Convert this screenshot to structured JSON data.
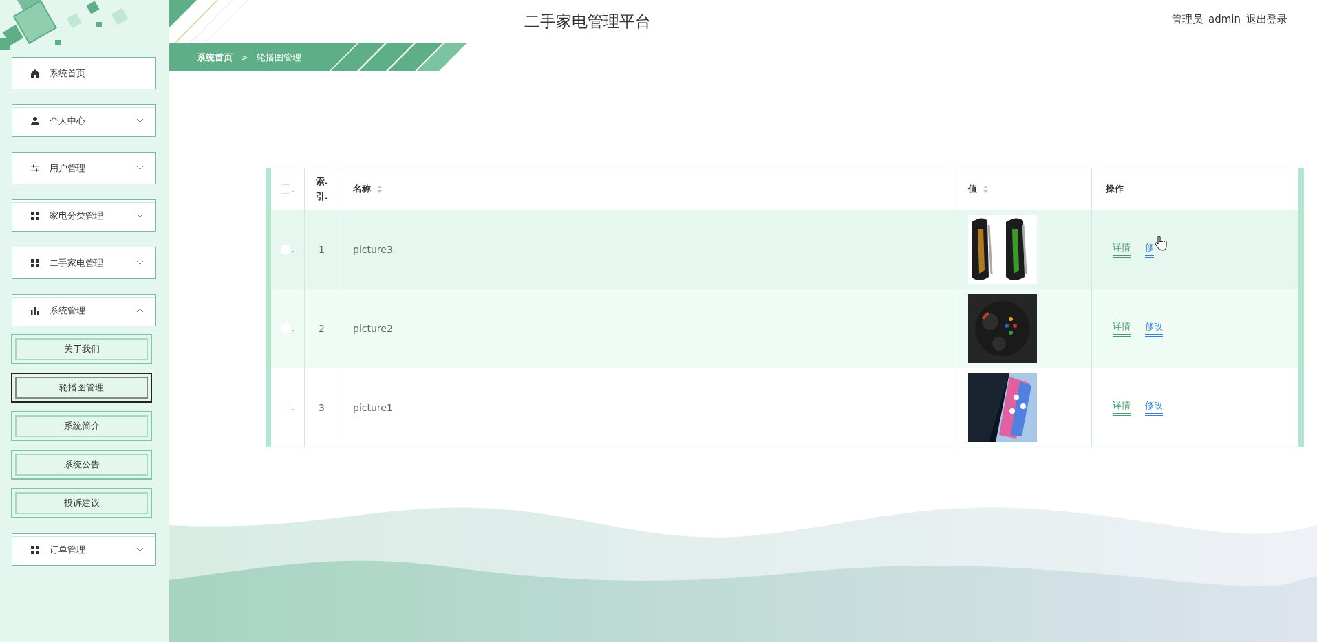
{
  "header": {
    "title": "二手家电管理平台",
    "user_role": "管理员",
    "username": "admin",
    "logout": "退出登录"
  },
  "breadcrumb": {
    "items": [
      "系统首页",
      "轮播图管理"
    ],
    "separator": ">"
  },
  "sidebar": {
    "items": [
      {
        "label": "系统首页",
        "kind": "link"
      },
      {
        "label": "个人中心",
        "kind": "group",
        "expanded": false
      },
      {
        "label": "用户管理",
        "kind": "group",
        "expanded": false
      },
      {
        "label": "家电分类管理",
        "kind": "group",
        "expanded": false
      },
      {
        "label": "二手家电管理",
        "kind": "group",
        "expanded": false
      },
      {
        "label": "系统管理",
        "kind": "group",
        "expanded": true,
        "children": [
          {
            "label": "关于我们",
            "selected": false
          },
          {
            "label": "轮播图管理",
            "selected": true
          },
          {
            "label": "系统简介",
            "selected": false
          },
          {
            "label": "系统公告",
            "selected": false
          },
          {
            "label": "投诉建议",
            "selected": false
          }
        ]
      },
      {
        "label": "订单管理",
        "kind": "group",
        "expanded": false
      }
    ]
  },
  "table": {
    "select_all": {
      "checked": false,
      "mark": "."
    },
    "index_header": "索. 引.",
    "columns": [
      {
        "label": "名称",
        "sortable": true
      },
      {
        "label": "值",
        "sortable": true
      },
      {
        "label": "操作"
      }
    ],
    "rows": [
      {
        "checked": false,
        "mark": ".",
        "index": "1",
        "name": "picture3",
        "hovered": true,
        "actions": [
          {
            "label": "详情",
            "kind": "detail"
          },
          {
            "label": "修",
            "kind": "edit"
          }
        ]
      },
      {
        "checked": false,
        "mark": ".",
        "index": "2",
        "name": "picture2",
        "hovered": false,
        "actions": [
          {
            "label": "详情",
            "kind": "detail"
          },
          {
            "label": "修改",
            "kind": "edit"
          }
        ]
      },
      {
        "checked": false,
        "mark": ".",
        "index": "3",
        "name": "picture1",
        "hovered": false,
        "actions": [
          {
            "label": "详情",
            "kind": "detail"
          },
          {
            "label": "修改",
            "kind": "edit"
          }
        ]
      }
    ]
  }
}
